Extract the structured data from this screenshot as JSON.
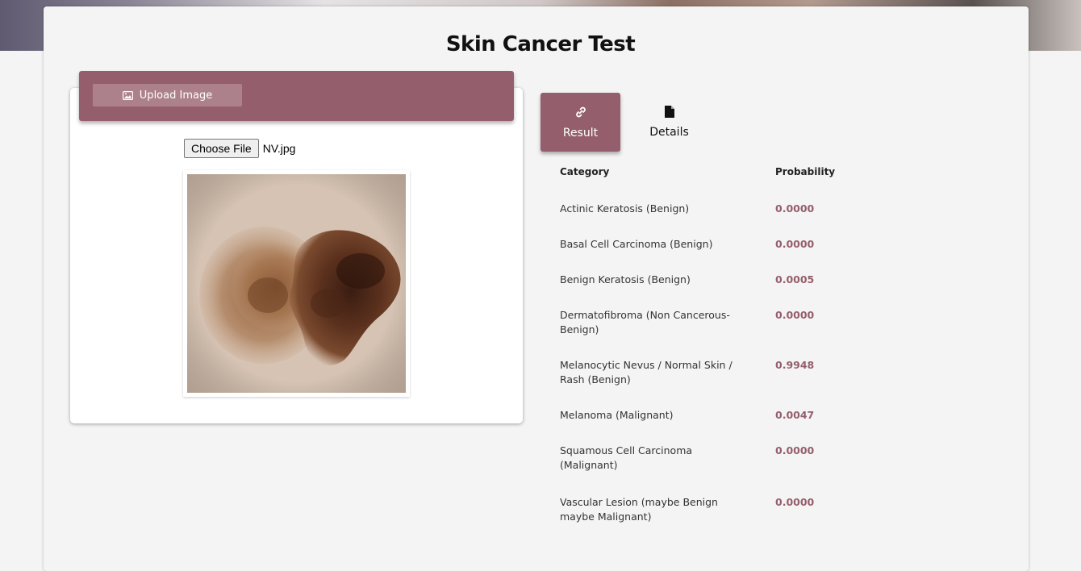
{
  "page": {
    "title": "Skin Cancer Test"
  },
  "upload": {
    "button_label": "Upload Image",
    "choose_file_label": "Choose File",
    "file_name": "NV.jpg"
  },
  "tabs": [
    {
      "label": "Result",
      "icon": "link-icon",
      "active": true
    },
    {
      "label": "Details",
      "icon": "document-icon",
      "active": false
    }
  ],
  "results": {
    "headers": {
      "category": "Category",
      "probability": "Probability"
    },
    "rows": [
      {
        "category": "Actinic Keratosis (Benign)",
        "probability": "0.0000"
      },
      {
        "category": "Basal Cell Carcinoma (Benign)",
        "probability": "0.0000"
      },
      {
        "category": "Benign Keratosis (Benign)",
        "probability": "0.0005"
      },
      {
        "category": "Dermatofibroma (Non Cancerous-Benign)",
        "probability": "0.0000"
      },
      {
        "category": "Melanocytic Nevus / Normal Skin / Rash (Benign)",
        "probability": "0.9948"
      },
      {
        "category": "Melanoma (Malignant)",
        "probability": "0.0047"
      },
      {
        "category": "Squamous Cell Carcinoma (Malignant)",
        "probability": "0.0000"
      },
      {
        "category": "Vascular Lesion (maybe Benign maybe Malignant)",
        "probability": "0.0000"
      }
    ]
  },
  "colors": {
    "accent": "#955e6c",
    "background": "#f4f4f4"
  }
}
